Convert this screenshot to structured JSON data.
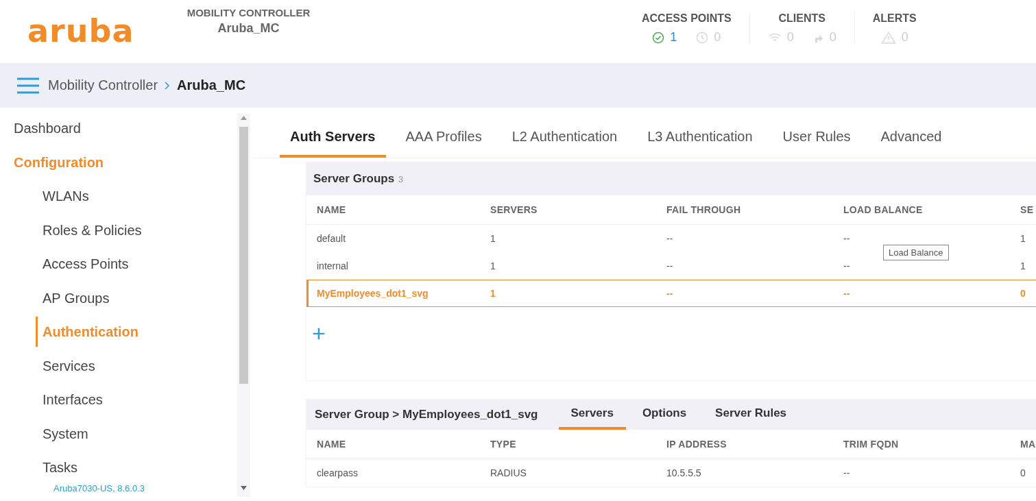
{
  "header": {
    "logo": "aruba",
    "subtitle": "MOBILITY CONTROLLER",
    "name": "Aruba_MC",
    "stats": [
      {
        "label": "ACCESS POINTS",
        "items": [
          {
            "kind": "up",
            "value": "1",
            "active": true
          },
          {
            "kind": "pending",
            "value": "0",
            "active": false
          }
        ]
      },
      {
        "label": "CLIENTS",
        "items": [
          {
            "kind": "wireless",
            "value": "0",
            "active": false
          },
          {
            "kind": "wired",
            "value": "0",
            "active": false
          }
        ]
      },
      {
        "label": "ALERTS",
        "items": [
          {
            "kind": "alerts",
            "value": "0",
            "active": false
          }
        ]
      }
    ]
  },
  "breadcrumb": [
    "Mobility Controller",
    "Aruba_MC"
  ],
  "sidebar": {
    "items": [
      {
        "label": "Dashboard",
        "selected": false
      },
      {
        "label": "Configuration",
        "selected": true,
        "children": [
          {
            "label": "WLANs",
            "selected": false
          },
          {
            "label": "Roles & Policies",
            "selected": false
          },
          {
            "label": "Access Points",
            "selected": false
          },
          {
            "label": "AP Groups",
            "selected": false
          },
          {
            "label": "Authentication",
            "selected": true
          },
          {
            "label": "Services",
            "selected": false
          },
          {
            "label": "Interfaces",
            "selected": false
          },
          {
            "label": "System",
            "selected": false
          },
          {
            "label": "Tasks",
            "selected": false
          }
        ]
      }
    ],
    "footer": "Aruba7030-US, 8.6.0.3"
  },
  "tabs": [
    {
      "label": "Auth Servers",
      "selected": true
    },
    {
      "label": "AAA Profiles",
      "selected": false
    },
    {
      "label": "L2 Authentication",
      "selected": false
    },
    {
      "label": "L3 Authentication",
      "selected": false
    },
    {
      "label": "User Rules",
      "selected": false
    },
    {
      "label": "Advanced",
      "selected": false
    }
  ],
  "server_groups": {
    "title": "Server Groups",
    "count": "3",
    "columns": [
      "NAME",
      "SERVERS",
      "FAIL THROUGH",
      "LOAD BALANCE",
      "SE"
    ],
    "rows": [
      {
        "cells": [
          "default",
          "1",
          "--",
          "--",
          "1"
        ],
        "selected": false
      },
      {
        "cells": [
          "internal",
          "1",
          "--",
          "--",
          "1"
        ],
        "selected": false
      },
      {
        "cells": [
          "MyEmployees_dot1_svg",
          "1",
          "--",
          "--",
          "0"
        ],
        "selected": true
      }
    ],
    "tooltip": "Load Balance",
    "add_button": "+"
  },
  "server_group_detail": {
    "title": "Server Group > MyEmployees_dot1_svg",
    "tabs": [
      {
        "label": "Servers",
        "selected": true
      },
      {
        "label": "Options",
        "selected": false
      },
      {
        "label": "Server Rules",
        "selected": false
      }
    ],
    "columns": [
      "NAME",
      "TYPE",
      "IP ADDRESS",
      "TRIM FQDN",
      "MA"
    ],
    "rows": [
      {
        "cells": [
          "clearpass",
          "RADIUS",
          "10.5.5.5",
          "--",
          "0"
        ]
      }
    ]
  }
}
